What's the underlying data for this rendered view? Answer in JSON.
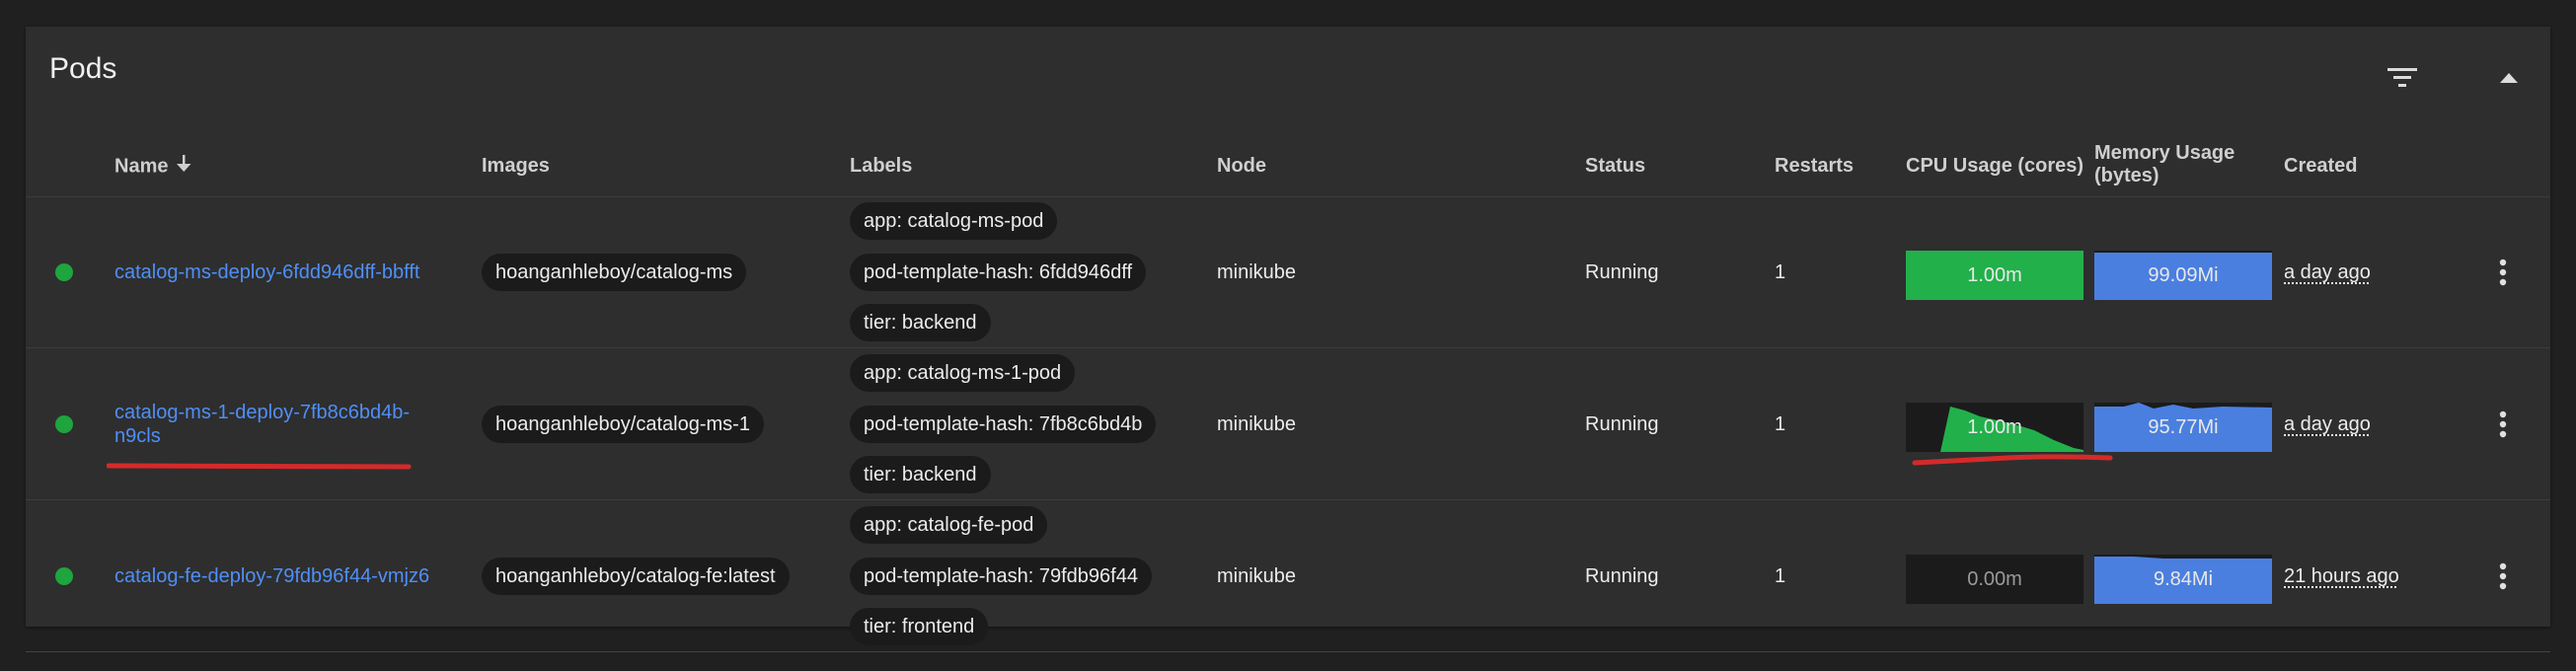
{
  "card": {
    "title": "Pods"
  },
  "header_icons": {
    "filter": "filter-icon",
    "collapse": "collapse-up-icon"
  },
  "columns": {
    "name": "Name",
    "images": "Images",
    "labels": "Labels",
    "node": "Node",
    "status": "Status",
    "restarts": "Restarts",
    "cpu": "CPU Usage (cores)",
    "memory_line1": "Memory Usage",
    "memory_line2": "(bytes)",
    "created": "Created"
  },
  "colors": {
    "accent_link": "#4f8ff7",
    "running_dot": "#1ea53d",
    "cpu_fill": "#22b04b",
    "mem_fill": "#4a7fe0",
    "annotation": "#d42a2a"
  },
  "pods": [
    {
      "name": "catalog-ms-deploy-6fdd946dff-bbfft",
      "name_line1": "catalog-ms-deploy-6fdd946dff-bbfft",
      "name_line2": "",
      "image": "hoanganhleboy/catalog-ms",
      "labels": [
        "app: catalog-ms-pod",
        "pod-template-hash: 6fdd946dff",
        "tier: backend"
      ],
      "node": "minikube",
      "status": "Running",
      "restarts": "1",
      "cpu": "1.00m",
      "memory": "99.09Mi",
      "created": "a day ago"
    },
    {
      "name": "catalog-ms-1-deploy-7fb8c6bd4b-n9cls",
      "name_line1": "catalog-ms-1-deploy-7fb8c6bd4b-",
      "name_line2": "n9cls",
      "image": "hoanganhleboy/catalog-ms-1",
      "labels": [
        "app: catalog-ms-1-pod",
        "pod-template-hash: 7fb8c6bd4b",
        "tier: backend"
      ],
      "node": "minikube",
      "status": "Running",
      "restarts": "1",
      "cpu": "1.00m",
      "memory": "95.77Mi",
      "created": "a day ago"
    },
    {
      "name": "catalog-fe-deploy-79fdb96f44-vmjz6",
      "name_line1": "catalog-fe-deploy-79fdb96f44-vmjz6",
      "name_line2": "",
      "image": "hoanganhleboy/catalog-fe:latest",
      "labels": [
        "app: catalog-fe-pod",
        "pod-template-hash: 79fdb96f44",
        "tier: frontend"
      ],
      "node": "minikube",
      "status": "Running",
      "restarts": "1",
      "cpu": "0.00m",
      "memory": "9.84Mi",
      "created": "21 hours ago"
    }
  ]
}
